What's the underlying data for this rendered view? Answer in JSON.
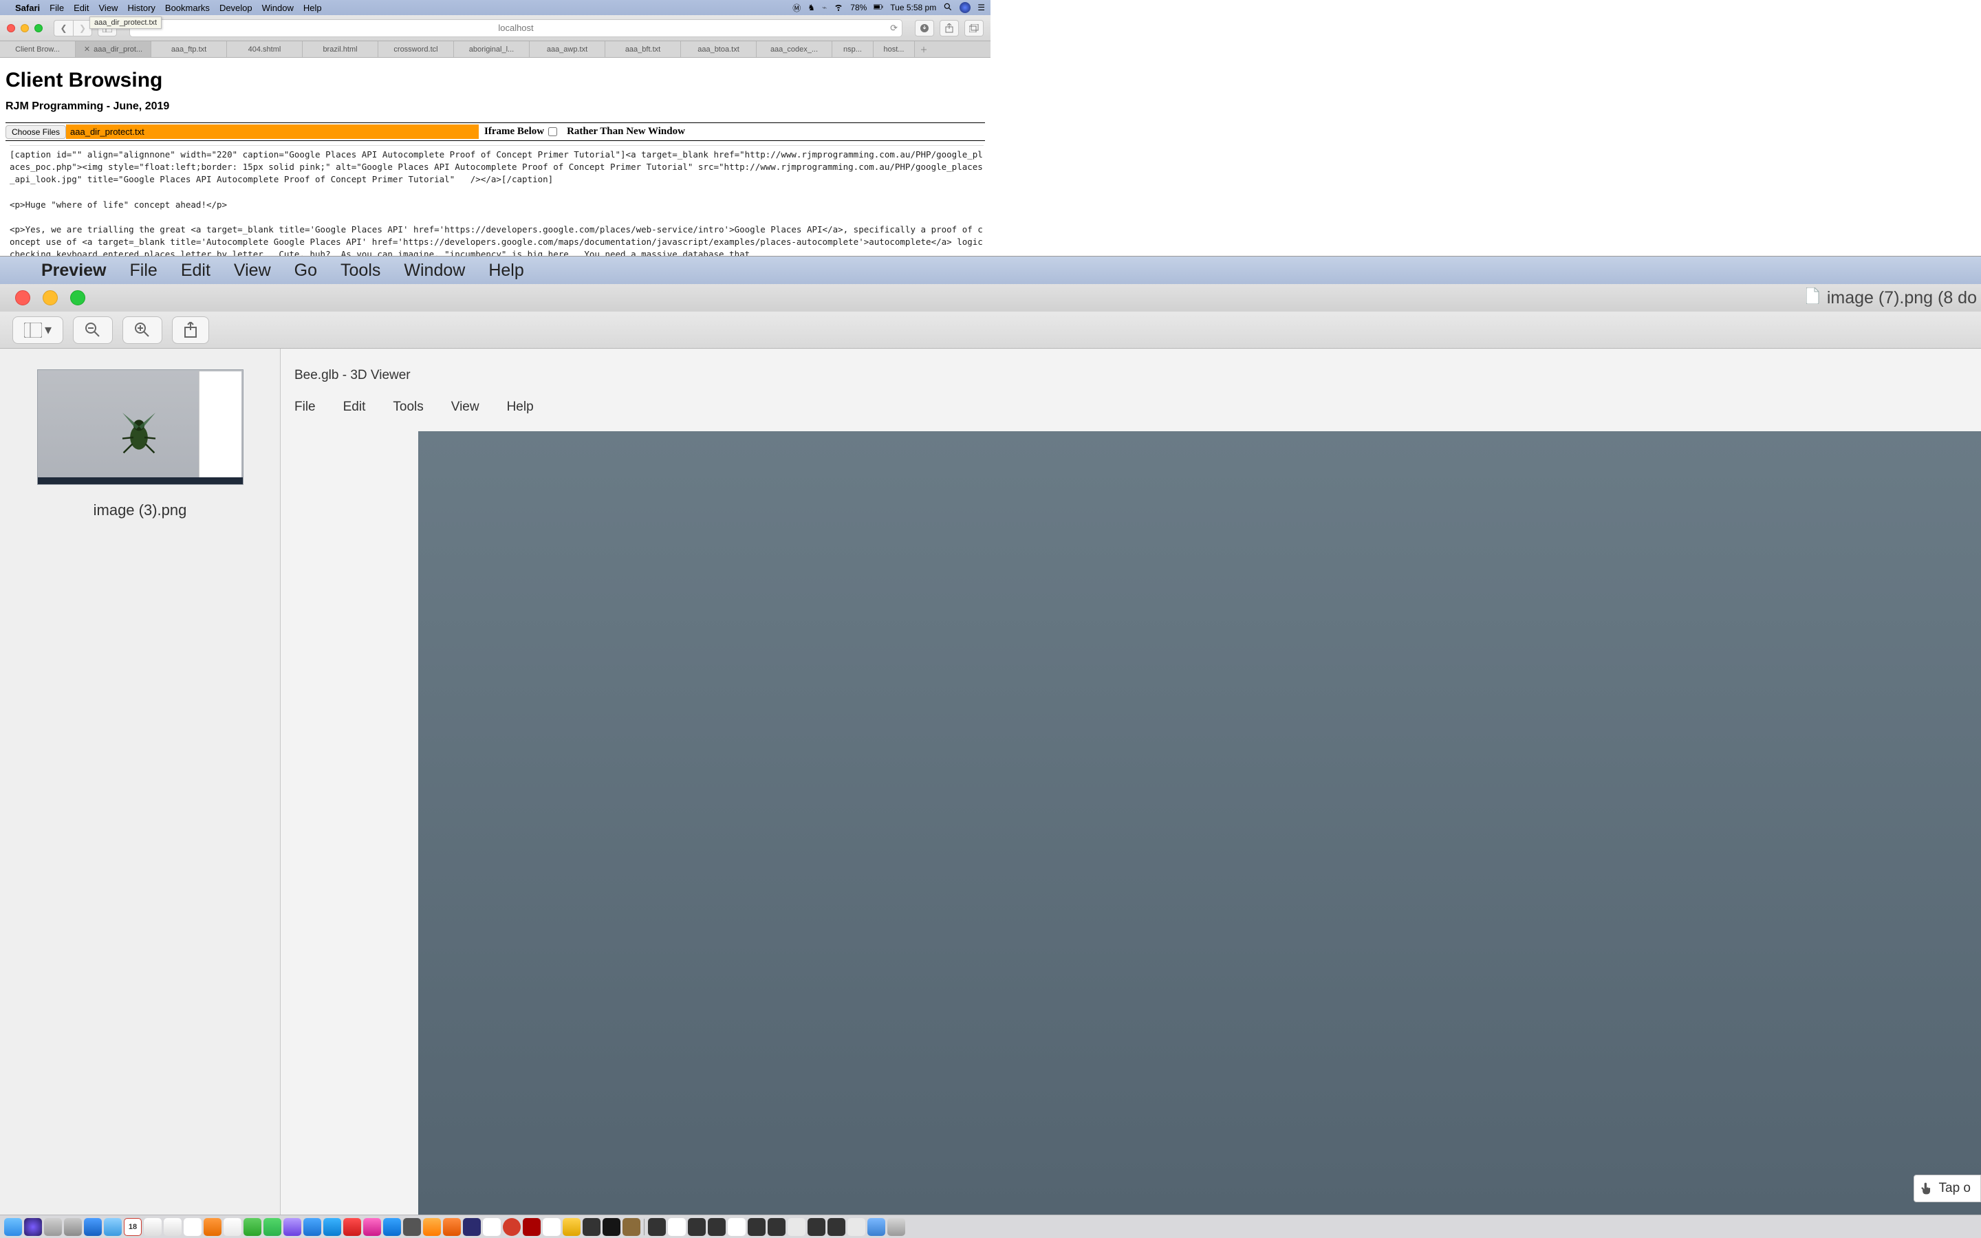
{
  "mac_menu": {
    "app": "Safari",
    "items": [
      "File",
      "Edit",
      "View",
      "History",
      "Bookmarks",
      "Develop",
      "Window",
      "Help"
    ],
    "battery": "78%",
    "clock": "Tue 5:58 pm"
  },
  "safari": {
    "address": "localhost",
    "tabs": [
      "Client Brow...",
      "aaa_dir_prot...",
      "aaa_ftp.txt",
      "404.shtml",
      "brazil.html",
      "crossword.tcl",
      "aboriginal_l...",
      "aaa_awp.txt",
      "aaa_bft.txt",
      "aaa_btoa.txt",
      "aaa_codex_...",
      "nsp...",
      "host..."
    ],
    "active_tab_index": 1,
    "tooltip": "aaa_dir_protect.txt"
  },
  "page": {
    "h1": "Client Browsing",
    "h3": "RJM Programming - June, 2019",
    "choose_btn": "Choose Files",
    "chosen_file": "aaa_dir_protect.txt",
    "iframe_label_left": "Iframe Below",
    "iframe_label_right": "Rather Than New Window",
    "code": "[caption id=\"\" align=\"alignnone\" width=\"220\" caption=\"Google Places API Autocomplete Proof of Concept Primer Tutorial\"]<a target=_blank href=\"http://www.rjmprogramming.com.au/PHP/google_places_poc.php\"><img style=\"float:left;border: 15px solid pink;\" alt=\"Google Places API Autocomplete Proof of Concept Primer Tutorial\" src=\"http://www.rjmprogramming.com.au/PHP/google_places_api_look.jpg\" title=\"Google Places API Autocomplete Proof of Concept Primer Tutorial\"   /></a>[/caption]\n\n<p>Huge \"where of life\" concept ahead!</p>\n\n<p>Yes, we are trialling the great <a target=_blank title='Google Places API' href='https://developers.google.com/places/web-service/intro'>Google Places API</a>, specifically a proof of concept use of <a target=_blank title='Autocomplete Google Places API' href='https://developers.google.com/maps/documentation/javascript/examples/places-autocomplete'>autocomplete</a> logic checking keyboard entered places letter by letter.  Cute, huh?  As you can imagine, \"incumbency\" is big here.  You need a massive database that"
  },
  "preview": {
    "app": "Preview",
    "menu": [
      "File",
      "Edit",
      "View",
      "Go",
      "Tools",
      "Window",
      "Help"
    ],
    "doc_title": "image (7).png (8 do",
    "thumb_caption": "image (3).png",
    "viewer_title": "Bee.glb - 3D Viewer",
    "viewer_menu": [
      "File",
      "Edit",
      "Tools",
      "View",
      "Help"
    ],
    "tap_label": "Tap o"
  },
  "dock": {
    "calendar_day": "18",
    "icons": 40
  }
}
